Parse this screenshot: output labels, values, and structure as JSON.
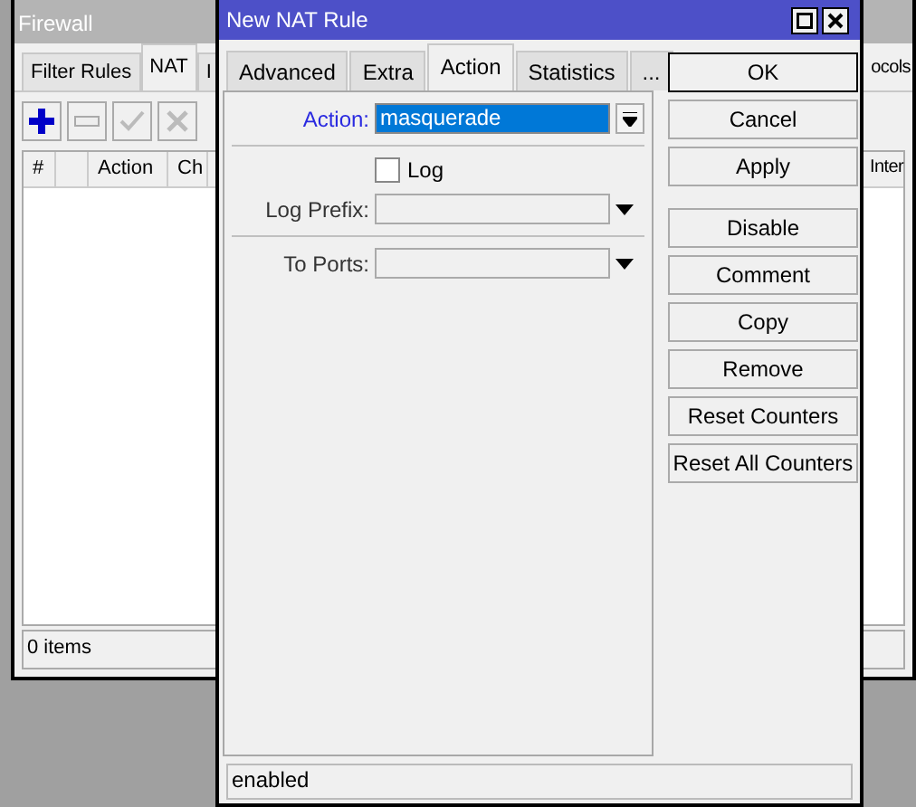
{
  "background_window": {
    "title": "Firewall",
    "tabs": [
      {
        "label": "Filter Rules",
        "selected": false
      },
      {
        "label": "NAT",
        "selected": true
      },
      {
        "label": "I",
        "selected": false
      }
    ],
    "right_tab_fragment": "ocols",
    "columns": [
      "#",
      "",
      "Action",
      "Ch"
    ],
    "right_column_fragment": "Inter",
    "status_bar": "0 items"
  },
  "dialog": {
    "title": "New NAT Rule",
    "tabs": [
      {
        "label": "Advanced",
        "selected": false
      },
      {
        "label": "Extra",
        "selected": false
      },
      {
        "label": "Action",
        "selected": true
      },
      {
        "label": "Statistics",
        "selected": false
      },
      {
        "label": "...",
        "selected": false
      }
    ],
    "action": {
      "label": "Action:",
      "value": "masquerade"
    },
    "log": {
      "label": "Log",
      "checked": false
    },
    "log_prefix": {
      "label": "Log Prefix:"
    },
    "to_ports": {
      "label": "To Ports:"
    },
    "buttons": [
      {
        "label": "OK",
        "default": true
      },
      {
        "label": "Cancel",
        "default": false
      },
      {
        "label": "Apply",
        "default": false
      },
      {
        "label": "Disable",
        "default": false
      },
      {
        "label": "Comment",
        "default": false
      },
      {
        "label": "Copy",
        "default": false
      },
      {
        "label": "Remove",
        "default": false
      },
      {
        "label": "Reset Counters",
        "default": false
      },
      {
        "label": "Reset All Counters",
        "default": false
      }
    ],
    "status_bar": "enabled"
  }
}
